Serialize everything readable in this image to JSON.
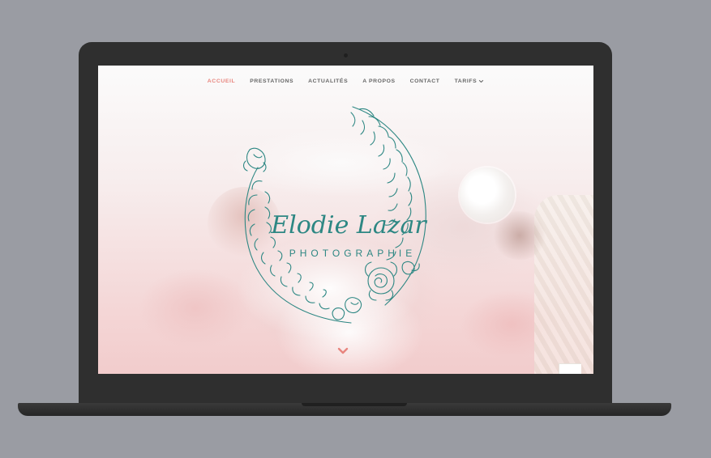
{
  "nav": {
    "items": [
      {
        "label": "ACCUEIL",
        "active": true
      },
      {
        "label": "PRESTATIONS"
      },
      {
        "label": "ACTUALITÉS"
      },
      {
        "label": "A PROPOS"
      },
      {
        "label": "CONTACT"
      },
      {
        "label": "TARIFS",
        "icon": "chevron-down-icon"
      }
    ]
  },
  "logo": {
    "title": "Elodie Lazar",
    "subtitle": "PHOTOGRAPHIE"
  },
  "colors": {
    "accent": "#e8857e",
    "brand": "#2d8783"
  },
  "scroll": {
    "icon": "chevron-down-icon"
  }
}
